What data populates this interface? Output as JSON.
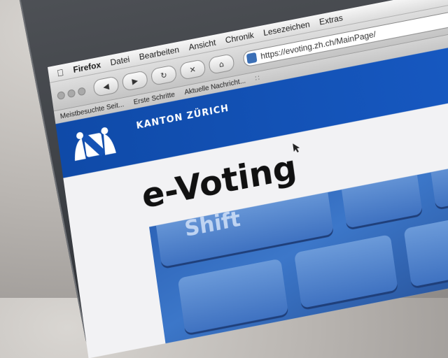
{
  "menubar": {
    "app": "Firefox",
    "items": [
      "Datei",
      "Bearbeiten",
      "Ansicht",
      "Chronik",
      "Lesezeichen",
      "Extras"
    ]
  },
  "toolbar": {
    "url": "https://evoting.zh.ch/MainPage/"
  },
  "bookmarks": {
    "items": [
      "Meistbesuchte Seit...",
      "Erste Schritte",
      "Aktuelle Nachricht..."
    ]
  },
  "page": {
    "header_title": "KANTON ZÜRICH",
    "headline": "e-Voting",
    "key_label": "Shift"
  },
  "colors": {
    "header_blue": "#1452b5",
    "key_blue": "#3f72c1"
  }
}
